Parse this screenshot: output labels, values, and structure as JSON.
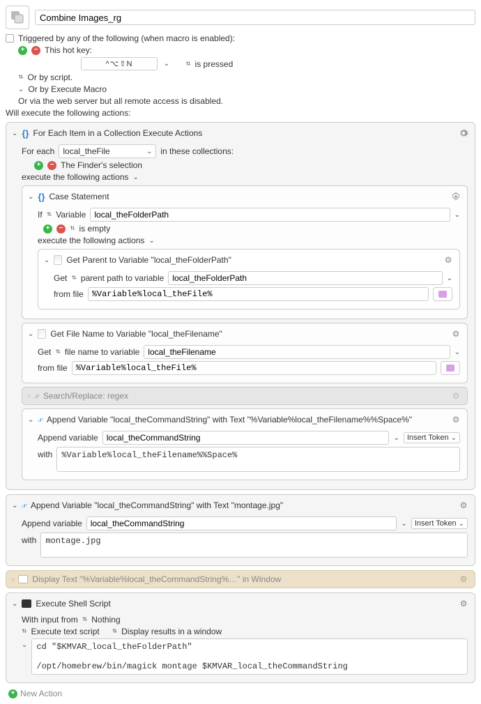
{
  "header": {
    "title": "Combine Images_rg"
  },
  "trigger": {
    "label": "Triggered by any of the following (when macro is enabled):",
    "hotkey": {
      "label": "This hot key:",
      "combo": "^⌥⇧N",
      "mode": "is pressed"
    },
    "script": "Or by script.",
    "executeMacro": "Or by Execute Macro",
    "webserver": "Or via the web server but all remote access is disabled."
  },
  "willExecute": "Will execute the following actions:",
  "foreach": {
    "title": "For Each Item in a Collection Execute Actions",
    "forEachLabel": "For each",
    "varName": "local_theFile",
    "inTheseCollections": "in these collections:",
    "collection": "The Finder's selection",
    "executeLabel": "execute the following actions"
  },
  "caseStmt": {
    "title": "Case Statement",
    "ifLabel": "If",
    "variableLabel": "Variable",
    "variableValue": "local_theFolderPath",
    "condition": "is empty",
    "executeLabel": "execute the following actions"
  },
  "getParent": {
    "title": "Get Parent to Variable \"local_theFolderPath\"",
    "getLabel": "Get",
    "typeLabel": "parent path to variable",
    "variableValue": "local_theFolderPath",
    "fromFileLabel": "from file",
    "fromFileValue": "%Variable%local_theFile%"
  },
  "getFilename": {
    "title": "Get File Name to Variable \"local_theFilename\"",
    "getLabel": "Get",
    "typeLabel": "file name to variable",
    "variableValue": "local_theFilename",
    "fromFileLabel": "from file",
    "fromFileValue": "%Variable%local_theFile%"
  },
  "searchReplace": {
    "title": "Search/Replace: regex"
  },
  "append1": {
    "title": "Append Variable \"local_theCommandString\" with Text \"%Variable%local_theFilename%%Space%\"",
    "appendLabel": "Append variable",
    "variableValue": "local_theCommandString",
    "insertToken": "Insert Token",
    "withLabel": "with",
    "withValue": "%Variable%local_theFilename%%Space%"
  },
  "append2": {
    "title": "Append Variable \"local_theCommandString\" with Text \"montage.jpg\"",
    "appendLabel": "Append variable",
    "variableValue": "local_theCommandString",
    "insertToken": "Insert Token",
    "withLabel": "with",
    "withValue": "montage.jpg"
  },
  "displayText": {
    "title": "Display Text \"%Variable%local_theCommandString%…\" in Window"
  },
  "shell": {
    "title": "Execute Shell Script",
    "withInputLabel": "With input from",
    "inputSource": "Nothing",
    "mode1": "Execute text script",
    "mode2": "Display results in a window",
    "script": "cd \"$KMVAR_local_theFolderPath\"\n\n/opt/homebrew/bin/magick montage $KMVAR_local_theCommandString"
  },
  "newAction": "New Action"
}
